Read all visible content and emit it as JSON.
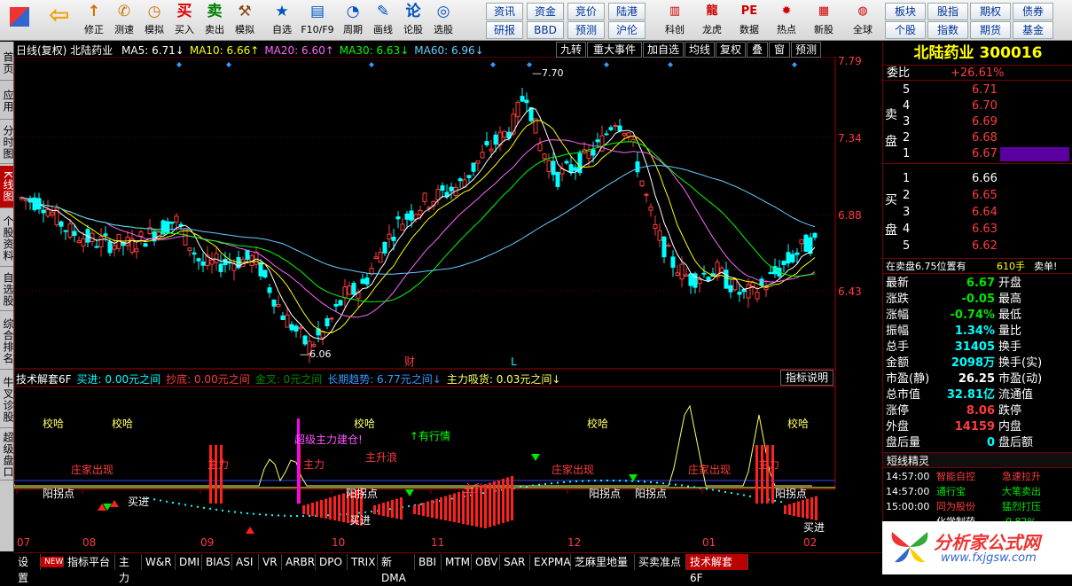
{
  "toolbar": {
    "left": [
      {
        "ic": "↑",
        "lb": "修正",
        "color": "#d07000",
        "icon": "up-arrow-icon"
      },
      {
        "ic": "✆",
        "lb": "测速",
        "color": "#d07000",
        "icon": "speed-icon"
      },
      {
        "ic": "◷",
        "lb": "模拟",
        "color": "#d07000",
        "icon": "clock-icon"
      },
      {
        "ic": "买",
        "lb": "买入",
        "color": "#e00000",
        "icon": "buy-icon"
      },
      {
        "ic": "卖",
        "lb": "卖出",
        "color": "#008000",
        "icon": "sell-icon"
      },
      {
        "ic": "⚒",
        "lb": "模拟",
        "color": "#8b4513",
        "icon": "hammer-icon"
      },
      {
        "ic": "★",
        "lb": "自选",
        "color": "#0050c0",
        "icon": "star-icon"
      },
      {
        "ic": "▤",
        "lb": "F10/F9",
        "color": "#0050c0",
        "icon": "f10-icon"
      },
      {
        "ic": "◔",
        "lb": "周期",
        "color": "#0050c0",
        "icon": "period-icon"
      },
      {
        "ic": "✎",
        "lb": "画线",
        "color": "#0050c0",
        "icon": "draw-icon"
      },
      {
        "ic": "论",
        "lb": "论股",
        "color": "#0050c0",
        "icon": "discuss-icon"
      },
      {
        "ic": "◎",
        "lb": "选股",
        "color": "#0050c0",
        "icon": "select-icon"
      }
    ],
    "quick": [
      "资讯",
      "资金",
      "竞价",
      "陆港",
      "研报",
      "BBD",
      "预测",
      "沪伦"
    ],
    "right": [
      {
        "ic": "▥",
        "lb": "科创",
        "icon": "kechuang-icon"
      },
      {
        "ic": "龍",
        "lb": "龙虎",
        "icon": "dragon-icon"
      },
      {
        "ic": "PE",
        "lb": "数据",
        "icon": "data-icon"
      },
      {
        "ic": "✹",
        "lb": "热点",
        "icon": "hot-icon"
      },
      {
        "ic": "▦",
        "lb": "新股",
        "icon": "newstock-icon"
      },
      {
        "ic": "◍",
        "lb": "全球",
        "icon": "globe-icon"
      }
    ],
    "quick2": [
      "板块",
      "股指",
      "期权",
      "债券",
      "个股",
      "指数",
      "期货",
      "基金"
    ]
  },
  "sidebar": [
    "首页",
    "应用",
    "分时图",
    "K线图",
    "个股资料",
    "自选股",
    "综合排名",
    "牛叉诊股",
    "超级盘口"
  ],
  "chart": {
    "header": "日线(复权) 北陆药业",
    "ma": [
      {
        "t": "MA5: 6.71↓",
        "c": "#ffffff"
      },
      {
        "t": "MA10: 6.66↑",
        "c": "#ffff00"
      },
      {
        "t": "MA20: 6.60↑",
        "c": "#ff66ff"
      },
      {
        "t": "MA30: 6.63↓",
        "c": "#00ff00"
      },
      {
        "t": "MA60: 6.96↓",
        "c": "#66ccff"
      }
    ],
    "tools": [
      "九转",
      "重大事件",
      "加自选",
      "均线",
      "复权",
      "叠",
      "窗",
      "预测"
    ],
    "price_ticks": [
      "7.79",
      "7.34",
      "6.88",
      "6.43"
    ],
    "high_label": "7.70",
    "low_label": "6.06",
    "marker_cai": "财",
    "marker_l": "L",
    "months": [
      "07",
      "08",
      "09",
      "10",
      "11",
      "12",
      "01",
      "02"
    ]
  },
  "indicator": {
    "header": [
      {
        "t": "技术解套6F",
        "c": "#ffffff"
      },
      {
        "t": "买进: 0.00元之间",
        "c": "#00ffff"
      },
      {
        "t": "抄底: 0.00元之间",
        "c": "#ff3c3c"
      },
      {
        "t": "金叉: 0元之间",
        "c": "#008800"
      },
      {
        "t": "长期趋势: 6.77元之间↓",
        "c": "#3399ff"
      },
      {
        "t": "主力吸货: 0.03元之间↓",
        "c": "#ffff66"
      }
    ],
    "help": "指标说明",
    "labels": [
      {
        "t": "校哈",
        "c": "#ffff66"
      },
      {
        "t": "校哈",
        "c": "#ffff66"
      },
      {
        "t": "校哈",
        "c": "#ffff66"
      },
      {
        "t": "校哈",
        "c": "#ffff66"
      },
      {
        "t": "校哈",
        "c": "#ffff66"
      },
      {
        "t": "超级主力建仓!",
        "c": "#ff55ff"
      },
      {
        "t": "↑有行情",
        "c": "#00ff00"
      },
      {
        "t": "主升浪",
        "c": "#ff3c3c"
      },
      {
        "t": "庄家出现",
        "c": "#ff3c3c"
      },
      {
        "t": "庄家出现",
        "c": "#ff3c3c"
      },
      {
        "t": "庄家出现",
        "c": "#ff3c3c"
      },
      {
        "t": "主力",
        "c": "#ff3c3c"
      },
      {
        "t": "主力",
        "c": "#ff3c3c"
      },
      {
        "t": "主力",
        "c": "#ff3c3c"
      },
      {
        "t": "阳拐点",
        "c": "#ffffff"
      },
      {
        "t": "阳拐点",
        "c": "#ffffff"
      },
      {
        "t": "阳拐点",
        "c": "#ffffff"
      },
      {
        "t": "阳拐点",
        "c": "#ffffff"
      },
      {
        "t": "阳拐点",
        "c": "#ffffff"
      },
      {
        "t": "买进",
        "c": "#ffffff"
      },
      {
        "t": "买进",
        "c": "#ffffff"
      },
      {
        "t": "买进",
        "c": "#ffffff"
      },
      {
        "t": "主升",
        "c": "#ff3c3c"
      }
    ]
  },
  "bottom_tabs": [
    "设置",
    "NEW",
    "指标平台",
    "主力",
    "W&R",
    "DMI",
    "BIAS",
    "ASI",
    "VR",
    "ARBR",
    "DPO",
    "TRIX",
    "新DMA",
    "BBI",
    "MTM",
    "OBV",
    "SAR",
    "EXPMA",
    "芝麻里地量",
    "买卖准点",
    "技术解套6F"
  ],
  "panel": {
    "title": "北陆药业 300016",
    "weibi_label": "委比",
    "weibi": "+26.61%",
    "sell_label": [
      "卖",
      "盘"
    ],
    "buy_label": [
      "买",
      "盘"
    ],
    "sells": [
      {
        "n": "5",
        "p": "6.71"
      },
      {
        "n": "4",
        "p": "6.70"
      },
      {
        "n": "3",
        "p": "6.69"
      },
      {
        "n": "2",
        "p": "6.68"
      },
      {
        "n": "1",
        "p": "6.67"
      }
    ],
    "buys": [
      {
        "n": "1",
        "p": "6.66"
      },
      {
        "n": "2",
        "p": "6.65"
      },
      {
        "n": "3",
        "p": "6.64"
      },
      {
        "n": "4",
        "p": "6.63"
      },
      {
        "n": "5",
        "p": "6.62"
      }
    ],
    "notice": "在卖盘6.75位置有",
    "notice_vol": "610手",
    "notice_tag": "卖单!",
    "stats": [
      {
        "l": "最新",
        "v": "6.67",
        "vc": "#00e600",
        "r": "开盘"
      },
      {
        "l": "涨跌",
        "v": "-0.05",
        "vc": "#00e600",
        "r": "最高"
      },
      {
        "l": "涨幅",
        "v": "-0.74%",
        "vc": "#00e600",
        "r": "最低"
      },
      {
        "l": "振幅",
        "v": "1.34%",
        "vc": "#00ffff",
        "r": "量比"
      },
      {
        "l": "总手",
        "v": "31405",
        "vc": "#00ffff",
        "r": "换手"
      },
      {
        "l": "金额",
        "v": "2098万",
        "vc": "#00ffff",
        "r": "换手(实)"
      },
      {
        "l": "市盈(静)",
        "v": "26.25",
        "vc": "#ffffff",
        "r": "市盈(动)"
      },
      {
        "l": "总市值",
        "v": "32.81亿",
        "vc": "#00ffff",
        "r": "流通值"
      },
      {
        "l": "涨停",
        "v": "8.06",
        "vc": "#ff3c3c",
        "r": "跌停"
      },
      {
        "l": "外盘",
        "v": "14159",
        "vc": "#ff3c3c",
        "r": "内盘"
      },
      {
        "l": "盘后量",
        "v": "0",
        "vc": "#00ffff",
        "r": "盘后额"
      }
    ],
    "elf_title": "短线精灵",
    "elf": [
      {
        "t": "14:57:00",
        "a": "智能自控",
        "ac": "#ff3c3c",
        "b": "急速拉升",
        "bc": "#ff3c3c"
      },
      {
        "t": "14:57:00",
        "a": "通行宝",
        "ac": "#00e600",
        "b": "大笔卖出",
        "bc": "#00e600"
      },
      {
        "t": "15:00:00",
        "a": "同为股份",
        "ac": "#ff3c3c",
        "b": "猛烈打压",
        "bc": "#00e600"
      },
      {
        "t": "",
        "a": "化学制药",
        "ac": "#ffffff",
        "b": "-0.82%",
        "bc": "#00e600"
      }
    ]
  },
  "logo": {
    "text": "分析家公式网",
    "url": "www.fxjgsw.com"
  }
}
